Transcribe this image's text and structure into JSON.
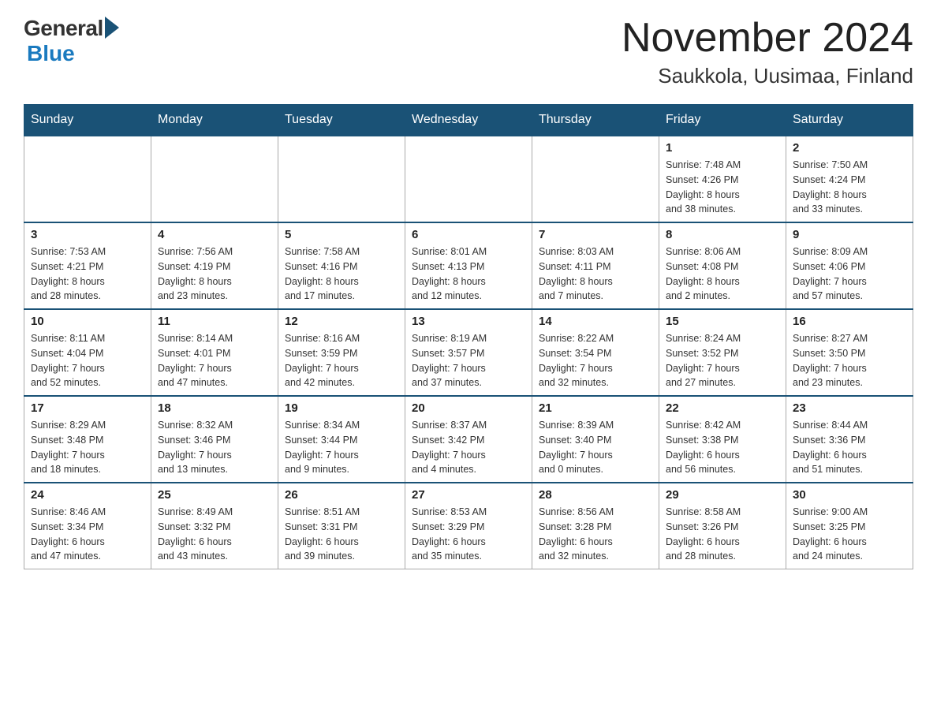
{
  "header": {
    "logo_general": "General",
    "logo_blue": "Blue",
    "month_title": "November 2024",
    "location": "Saukkola, Uusimaa, Finland"
  },
  "days_of_week": [
    "Sunday",
    "Monday",
    "Tuesday",
    "Wednesday",
    "Thursday",
    "Friday",
    "Saturday"
  ],
  "weeks": [
    [
      {
        "day": "",
        "info": ""
      },
      {
        "day": "",
        "info": ""
      },
      {
        "day": "",
        "info": ""
      },
      {
        "day": "",
        "info": ""
      },
      {
        "day": "",
        "info": ""
      },
      {
        "day": "1",
        "info": "Sunrise: 7:48 AM\nSunset: 4:26 PM\nDaylight: 8 hours\nand 38 minutes."
      },
      {
        "day": "2",
        "info": "Sunrise: 7:50 AM\nSunset: 4:24 PM\nDaylight: 8 hours\nand 33 minutes."
      }
    ],
    [
      {
        "day": "3",
        "info": "Sunrise: 7:53 AM\nSunset: 4:21 PM\nDaylight: 8 hours\nand 28 minutes."
      },
      {
        "day": "4",
        "info": "Sunrise: 7:56 AM\nSunset: 4:19 PM\nDaylight: 8 hours\nand 23 minutes."
      },
      {
        "day": "5",
        "info": "Sunrise: 7:58 AM\nSunset: 4:16 PM\nDaylight: 8 hours\nand 17 minutes."
      },
      {
        "day": "6",
        "info": "Sunrise: 8:01 AM\nSunset: 4:13 PM\nDaylight: 8 hours\nand 12 minutes."
      },
      {
        "day": "7",
        "info": "Sunrise: 8:03 AM\nSunset: 4:11 PM\nDaylight: 8 hours\nand 7 minutes."
      },
      {
        "day": "8",
        "info": "Sunrise: 8:06 AM\nSunset: 4:08 PM\nDaylight: 8 hours\nand 2 minutes."
      },
      {
        "day": "9",
        "info": "Sunrise: 8:09 AM\nSunset: 4:06 PM\nDaylight: 7 hours\nand 57 minutes."
      }
    ],
    [
      {
        "day": "10",
        "info": "Sunrise: 8:11 AM\nSunset: 4:04 PM\nDaylight: 7 hours\nand 52 minutes."
      },
      {
        "day": "11",
        "info": "Sunrise: 8:14 AM\nSunset: 4:01 PM\nDaylight: 7 hours\nand 47 minutes."
      },
      {
        "day": "12",
        "info": "Sunrise: 8:16 AM\nSunset: 3:59 PM\nDaylight: 7 hours\nand 42 minutes."
      },
      {
        "day": "13",
        "info": "Sunrise: 8:19 AM\nSunset: 3:57 PM\nDaylight: 7 hours\nand 37 minutes."
      },
      {
        "day": "14",
        "info": "Sunrise: 8:22 AM\nSunset: 3:54 PM\nDaylight: 7 hours\nand 32 minutes."
      },
      {
        "day": "15",
        "info": "Sunrise: 8:24 AM\nSunset: 3:52 PM\nDaylight: 7 hours\nand 27 minutes."
      },
      {
        "day": "16",
        "info": "Sunrise: 8:27 AM\nSunset: 3:50 PM\nDaylight: 7 hours\nand 23 minutes."
      }
    ],
    [
      {
        "day": "17",
        "info": "Sunrise: 8:29 AM\nSunset: 3:48 PM\nDaylight: 7 hours\nand 18 minutes."
      },
      {
        "day": "18",
        "info": "Sunrise: 8:32 AM\nSunset: 3:46 PM\nDaylight: 7 hours\nand 13 minutes."
      },
      {
        "day": "19",
        "info": "Sunrise: 8:34 AM\nSunset: 3:44 PM\nDaylight: 7 hours\nand 9 minutes."
      },
      {
        "day": "20",
        "info": "Sunrise: 8:37 AM\nSunset: 3:42 PM\nDaylight: 7 hours\nand 4 minutes."
      },
      {
        "day": "21",
        "info": "Sunrise: 8:39 AM\nSunset: 3:40 PM\nDaylight: 7 hours\nand 0 minutes."
      },
      {
        "day": "22",
        "info": "Sunrise: 8:42 AM\nSunset: 3:38 PM\nDaylight: 6 hours\nand 56 minutes."
      },
      {
        "day": "23",
        "info": "Sunrise: 8:44 AM\nSunset: 3:36 PM\nDaylight: 6 hours\nand 51 minutes."
      }
    ],
    [
      {
        "day": "24",
        "info": "Sunrise: 8:46 AM\nSunset: 3:34 PM\nDaylight: 6 hours\nand 47 minutes."
      },
      {
        "day": "25",
        "info": "Sunrise: 8:49 AM\nSunset: 3:32 PM\nDaylight: 6 hours\nand 43 minutes."
      },
      {
        "day": "26",
        "info": "Sunrise: 8:51 AM\nSunset: 3:31 PM\nDaylight: 6 hours\nand 39 minutes."
      },
      {
        "day": "27",
        "info": "Sunrise: 8:53 AM\nSunset: 3:29 PM\nDaylight: 6 hours\nand 35 minutes."
      },
      {
        "day": "28",
        "info": "Sunrise: 8:56 AM\nSunset: 3:28 PM\nDaylight: 6 hours\nand 32 minutes."
      },
      {
        "day": "29",
        "info": "Sunrise: 8:58 AM\nSunset: 3:26 PM\nDaylight: 6 hours\nand 28 minutes."
      },
      {
        "day": "30",
        "info": "Sunrise: 9:00 AM\nSunset: 3:25 PM\nDaylight: 6 hours\nand 24 minutes."
      }
    ]
  ]
}
